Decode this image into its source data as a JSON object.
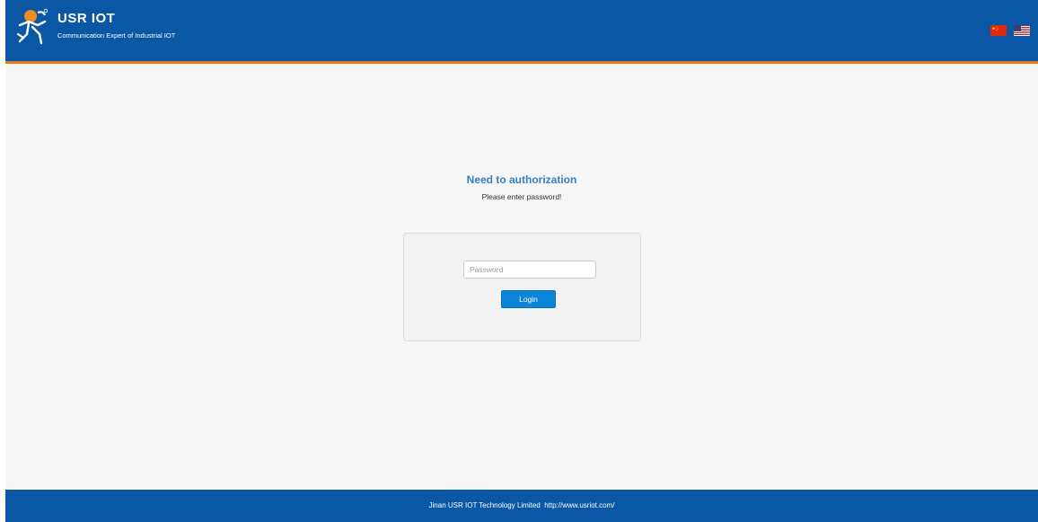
{
  "header": {
    "brand_name": "USR IOT",
    "tagline": "Communication Expert of Industrial IOT",
    "colors": {
      "background": "#0a58a5",
      "accent_line": "#e87a1e"
    },
    "languages": [
      {
        "icon": "flag-china-icon"
      },
      {
        "icon": "flag-usa-icon"
      }
    ]
  },
  "auth": {
    "title": "Need to authorization",
    "subtitle": "Please enter password!"
  },
  "login_form": {
    "password_placeholder": "Password",
    "password_value": "",
    "login_label": "Login",
    "button_color": "#0a84d6"
  },
  "footer": {
    "company": "Jinan USR IOT Technology Limited",
    "url": "http://www.usriot.com/"
  }
}
